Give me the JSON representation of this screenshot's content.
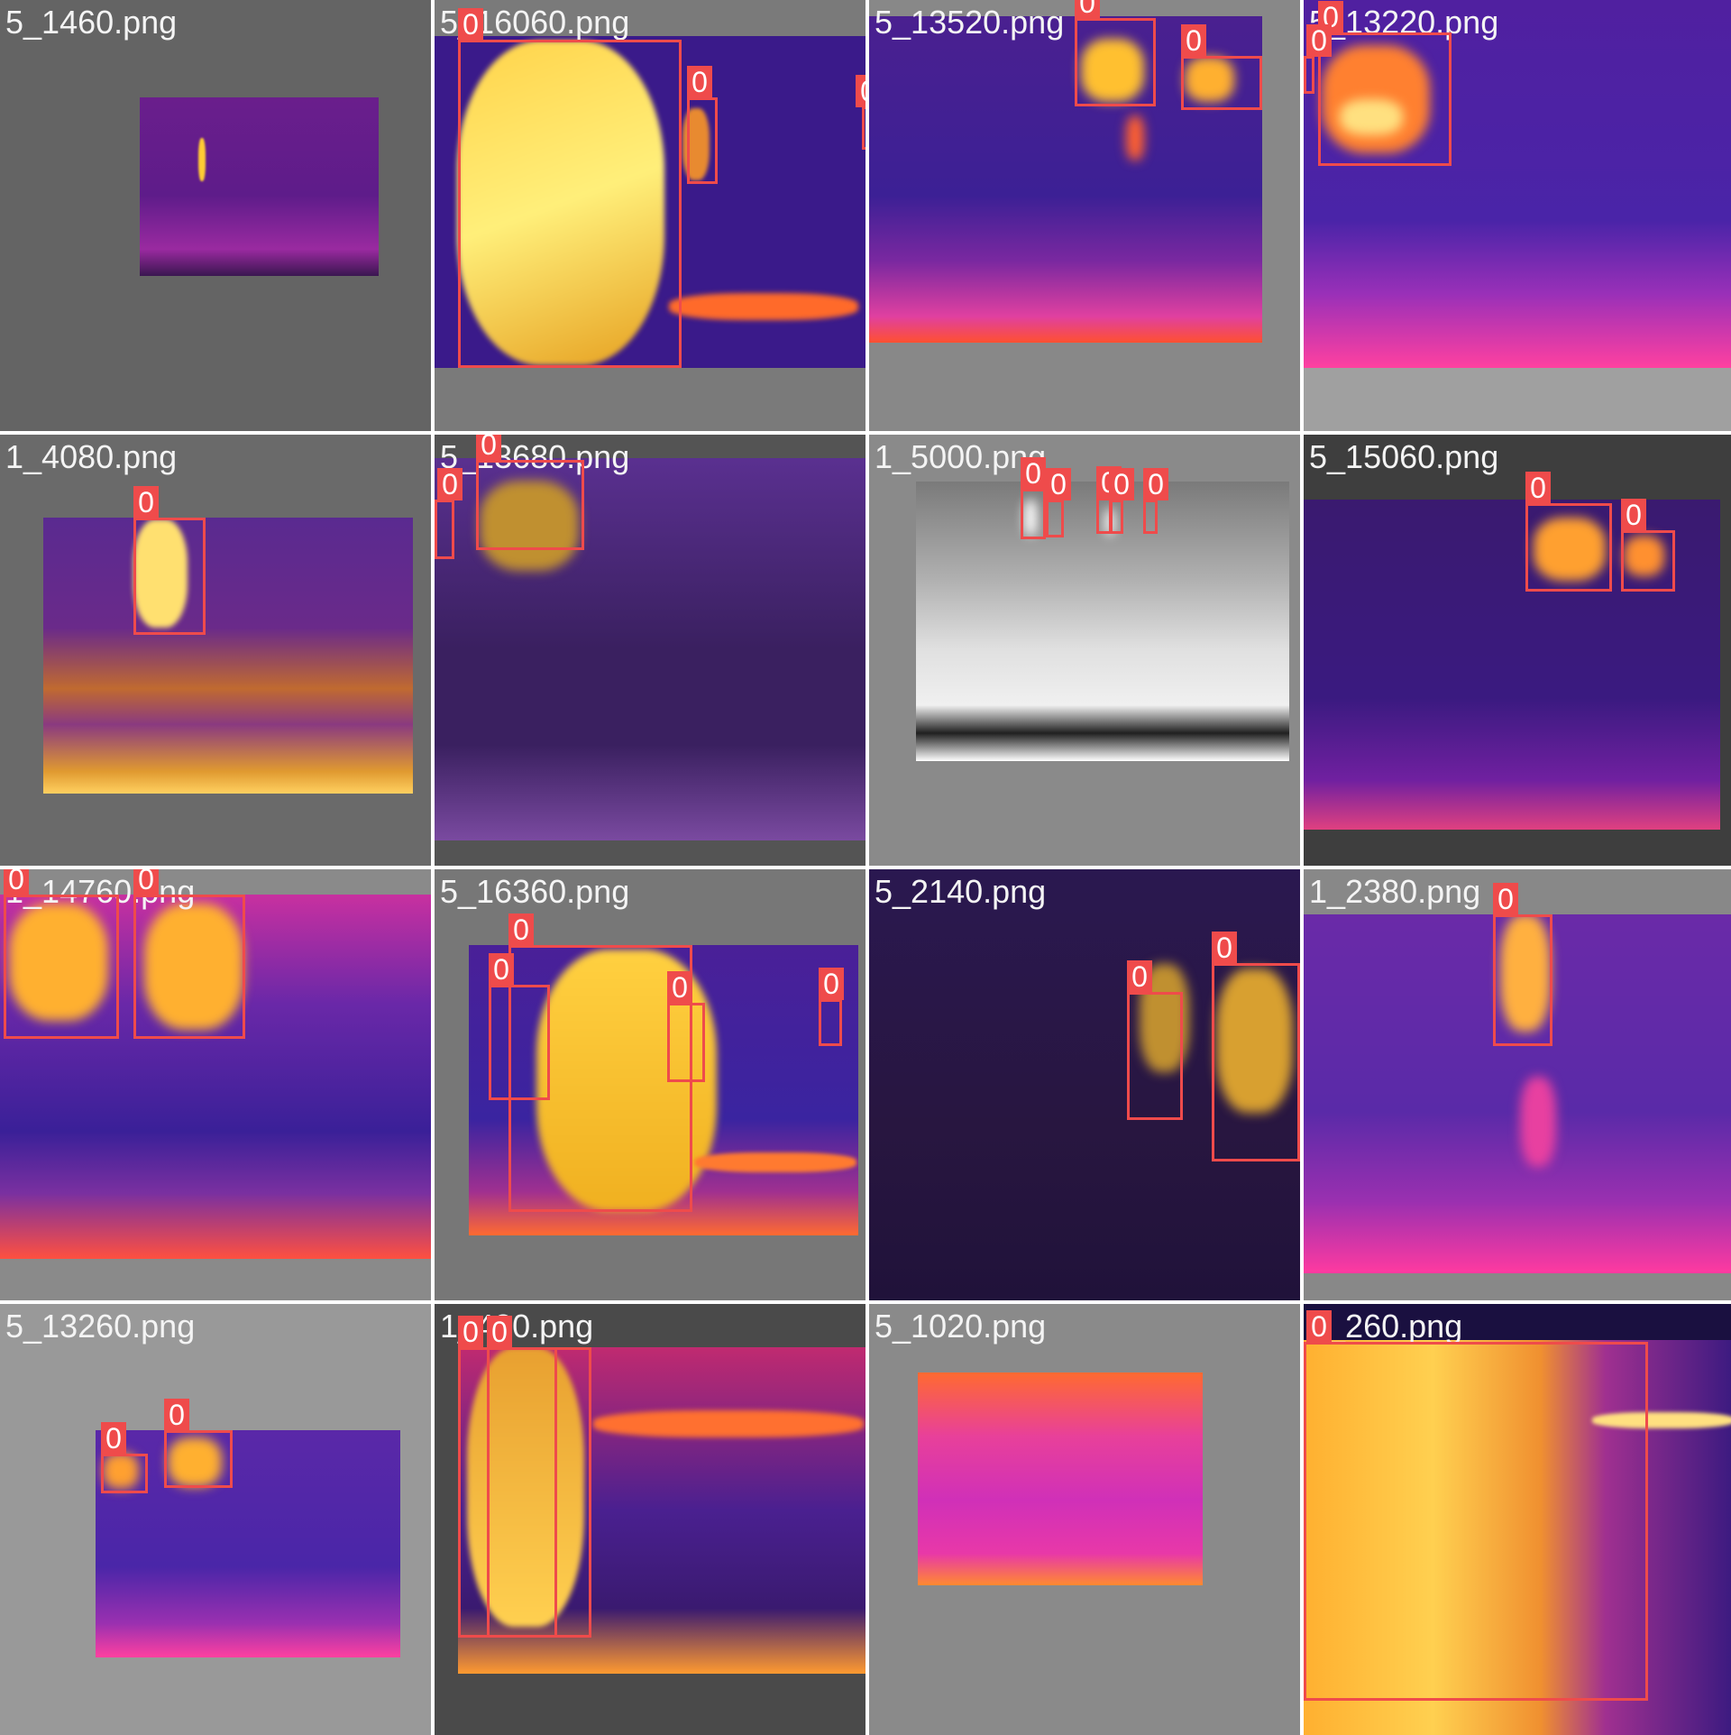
{
  "tiles": [
    {
      "filename": "5_1460.png"
    },
    {
      "filename": "5_16060.png"
    },
    {
      "filename": "5_13520.png"
    },
    {
      "filename": "5_13220.png"
    },
    {
      "filename": "1_4080.png"
    },
    {
      "filename": "5_13680.png"
    },
    {
      "filename": "1_5000.png"
    },
    {
      "filename": "5_15060.png"
    },
    {
      "filename": "1_14760.png"
    },
    {
      "filename": "5_16360.png"
    },
    {
      "filename": "5_2140.png"
    },
    {
      "filename": "1_2380.png"
    },
    {
      "filename": "5_13260.png"
    },
    {
      "filename": "1_480.png"
    },
    {
      "filename": "5_1020.png"
    },
    {
      "filename": "5_260.png"
    }
  ],
  "class_label": "0",
  "colors": {
    "box": "#ef4b4b",
    "label_text": "#ffffff",
    "filename_text": "#f4f4f4",
    "gap": "#ffffff"
  }
}
